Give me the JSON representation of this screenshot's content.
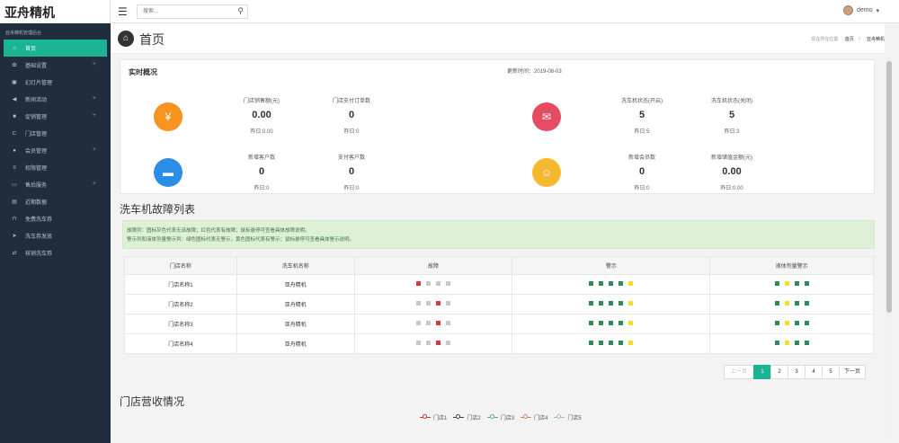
{
  "app": {
    "brand": "亚舟精机"
  },
  "topbar": {
    "search_placeholder": "搜索...",
    "user": "demo"
  },
  "sidebar": {
    "section": "亚舟精机管理后台",
    "items": [
      {
        "label": "首页",
        "icon": "home-icon",
        "glyph": "⌂",
        "active": true,
        "expand": false
      },
      {
        "label": "基础设置",
        "icon": "gear-icon",
        "glyph": "✿",
        "expand": true
      },
      {
        "label": "幻灯片管理",
        "icon": "image-icon",
        "glyph": "▣",
        "expand": false
      },
      {
        "label": "新闻活动",
        "icon": "bullhorn-icon",
        "glyph": "◀",
        "expand": true
      },
      {
        "label": "促销管理",
        "icon": "briefcase-icon",
        "glyph": "■",
        "expand": true
      },
      {
        "label": "门店管理",
        "icon": "car-icon",
        "glyph": "⊏",
        "expand": false
      },
      {
        "label": "会员管理",
        "icon": "user-icon",
        "glyph": "●",
        "expand": true
      },
      {
        "label": "权限管理",
        "icon": "list-icon",
        "glyph": "≡",
        "expand": false
      },
      {
        "label": "售后服务",
        "icon": "inbox-icon",
        "glyph": "▭",
        "expand": true
      },
      {
        "label": "近期数据",
        "icon": "file-icon",
        "glyph": "▤",
        "expand": false
      },
      {
        "label": "免费洗车券",
        "icon": "car-front-icon",
        "glyph": "⊓",
        "expand": false
      },
      {
        "label": "洗车券发放",
        "icon": "send-icon",
        "glyph": "➤",
        "expand": false
      },
      {
        "label": "核销洗车券",
        "icon": "exchange-icon",
        "glyph": "⇄",
        "expand": false
      }
    ]
  },
  "header": {
    "title": "首页",
    "crumb_prefix": "现在所在位置",
    "crumb_home": "首页",
    "crumb_current": "亚舟精机"
  },
  "overview": {
    "title": "实时概况",
    "update_time": "更新时间：2019-08-03",
    "stats": [
      {
        "label": "门店销售额(元)",
        "value": "0.00",
        "yesterday": "昨日:0.00"
      },
      {
        "label": "门店支付订单数",
        "value": "0",
        "yesterday": "昨日:0"
      },
      {
        "label": "洗车机状态(开启)",
        "value": "5",
        "yesterday": "昨日:5"
      },
      {
        "label": "洗车机状态(关闭)",
        "value": "5",
        "yesterday": "昨日:3"
      },
      {
        "label": "新增客户数",
        "value": "0",
        "yesterday": "昨日:0"
      },
      {
        "label": "支付客户数",
        "value": "0",
        "yesterday": "昨日:0"
      },
      {
        "label": "新增会员数",
        "value": "0",
        "yesterday": "昨日:0"
      },
      {
        "label": "新增储值金额(元)",
        "value": "0.00",
        "yesterday": "昨日:0.00"
      }
    ],
    "icon_colors": [
      "#f7931e",
      "#e54b63",
      "#2b8ee6",
      "#f5b82e"
    ]
  },
  "faults": {
    "title": "洗车机故障列表",
    "notice1": "故障列：图标灰色代表无该故障；红色代表有故障；鼠标悬停可查看具体故障说明。",
    "notice2": "警示列和液体剂量警示列：绿色图标代表无警示，黄色图标代表有警示；鼠标悬停可查看具体警示说明。",
    "columns": [
      "门店名称",
      "洗车机名称",
      "故障",
      "警示",
      "液体剂量警示"
    ],
    "rows": [
      {
        "store": "门店名称1",
        "machine": "亚舟精机",
        "faults": [
          "red",
          "grey",
          "grey",
          "grey"
        ]
      },
      {
        "store": "门店名称2",
        "machine": "亚舟精机",
        "faults": [
          "grey",
          "grey",
          "red",
          "grey"
        ]
      },
      {
        "store": "门店名称3",
        "machine": "亚舟精机",
        "faults": [
          "grey",
          "grey",
          "red",
          "grey"
        ]
      },
      {
        "store": "门店名称4",
        "machine": "亚舟精机",
        "faults": [
          "grey",
          "grey",
          "red",
          "grey"
        ]
      }
    ],
    "warn_colors": [
      "#2e8b57",
      "#2e8b57",
      "#2e8b57",
      "#2e8b57",
      "#f4e022"
    ],
    "liquid_colors": [
      "#2e8b57",
      "#f4e022",
      "#2e8b57",
      "#2e8b57"
    ]
  },
  "pagination": {
    "prev": "上一页",
    "pages": [
      "1",
      "2",
      "3",
      "4",
      "5"
    ],
    "current": "1",
    "next": "下一页"
  },
  "revenue": {
    "title": "门店营收情况",
    "legend": [
      {
        "name": "门店1",
        "color": "#c23531"
      },
      {
        "name": "门店2",
        "color": "#2f4554"
      },
      {
        "name": "门店3",
        "color": "#61a0a8"
      },
      {
        "name": "门店4",
        "color": "#d48265"
      },
      {
        "name": "门店5",
        "color": "#91c7ae"
      }
    ]
  }
}
